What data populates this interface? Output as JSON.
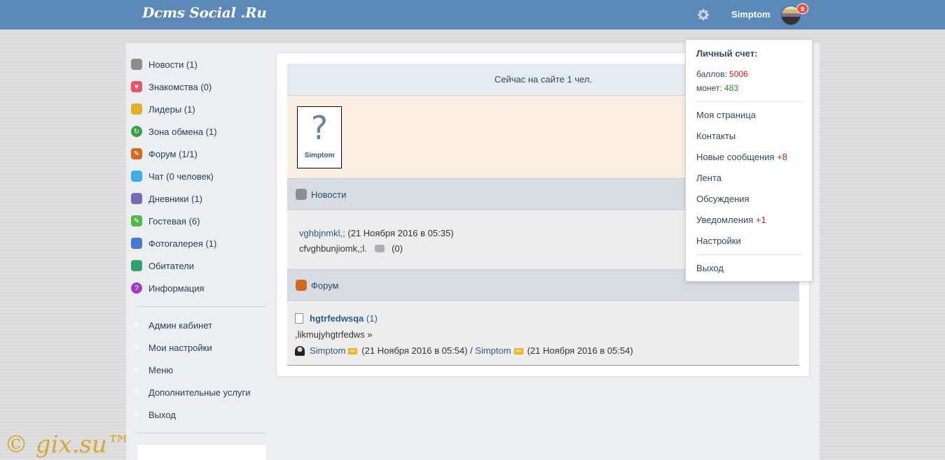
{
  "header": {
    "logo": "Dcms Social .Ru",
    "username": "Simptom",
    "notification_count": "9"
  },
  "sidebar": {
    "items": [
      {
        "label": "Новости (1)",
        "icon": "news-icon",
        "color": "#8e8e8e"
      },
      {
        "label": "Знакомства (0)",
        "icon": "heart-icon",
        "color": "#e8566a"
      },
      {
        "label": "Лидеры (1)",
        "icon": "trophy-icon",
        "color": "#e0b030"
      },
      {
        "label": "Зона обмена (1)",
        "icon": "recycle-icon",
        "color": "#3aa048"
      },
      {
        "label": "Форум (1/1)",
        "icon": "pencil-icon",
        "color": "#d06a20"
      },
      {
        "label": "Чат (0 человек)",
        "icon": "chat-icon",
        "color": "#3ab0e8"
      },
      {
        "label": "Дневники (1)",
        "icon": "diary-icon",
        "color": "#7a6ab0"
      },
      {
        "label": "Гостевая (6)",
        "icon": "guestbook-icon",
        "color": "#50b848"
      },
      {
        "label": "Фотогалерея (1)",
        "icon": "camera-icon",
        "color": "#4a7ad0"
      },
      {
        "label": "Обитатели",
        "icon": "people-icon",
        "color": "#30a070"
      },
      {
        "label": "Информация",
        "icon": "info-icon",
        "color": "#9a40c0"
      }
    ],
    "admin_items": [
      {
        "label": "Админ кабинет"
      },
      {
        "label": "Мои настройки"
      },
      {
        "label": "Меню"
      },
      {
        "label": "Дополнительные услуги"
      },
      {
        "label": "Выход"
      }
    ]
  },
  "main": {
    "online_text": "Сейчас на сайте 1 чел.",
    "online_user": {
      "name": "Simptom",
      "avatar_glyph": "?"
    },
    "news": {
      "heading": "Новости",
      "title": "vghbjnmkl,;",
      "date": "(21 Ноября 2016 в 05:35)",
      "text": "cfvghbunjiomk,;l.",
      "comments": "(0)"
    },
    "forum": {
      "heading": "Форум",
      "topic": "hgtrfedwsqa",
      "count": "(1)",
      "excerpt": ",likmujyhgtrfedws »",
      "author": "Simptom",
      "author_date": "(21 Ноября 2016 в 05:54) /",
      "last_user": "Simptom",
      "last_date": "(21 Ноября 2016 в 05:54)",
      "on_label": "on"
    }
  },
  "dropdown": {
    "title": "Личный счет:",
    "points_label": "баллов:",
    "points_value": "5006",
    "coins_label": "монет:",
    "coins_value": "483",
    "items": {
      "my_page": "Моя страница",
      "contacts": "Контакты",
      "messages": "Новые сообщения",
      "messages_count": "+8",
      "feed": "Лента",
      "discussions": "Обсуждения",
      "notifications": "Уведомления",
      "notifications_count": "+1",
      "settings": "Настройки",
      "logout": "Выход"
    }
  },
  "watermark": "© gix.su™"
}
